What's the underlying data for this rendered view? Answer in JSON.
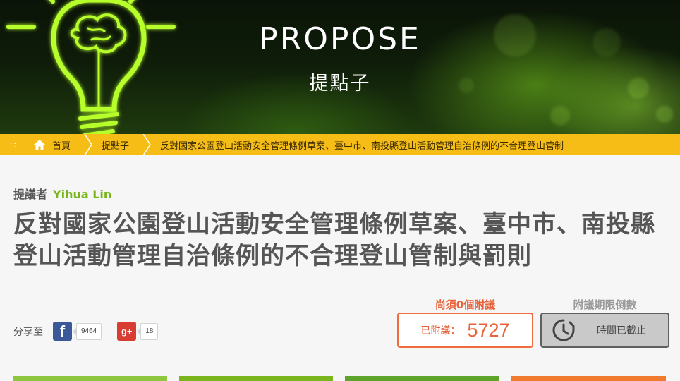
{
  "hero": {
    "title": "PROPOSE",
    "subtitle": "提點子"
  },
  "breadcrumb": {
    "menu_glyph": ":::",
    "items": [
      {
        "label": "首頁",
        "icon": "home-icon"
      },
      {
        "label": "提點子"
      },
      {
        "label": "反對國家公園登山活動安全管理條例草案、臺中市、南投縣登山活動管理自治條例的不合理登山管制"
      }
    ]
  },
  "proposal": {
    "proposer_label": "提議者",
    "proposer_name": "Yihua Lin",
    "title": "反對國家公園登山活動安全管理條例草案、臺中市、南投縣登山活動管理自治條例的不合理登山管制與罰則"
  },
  "share": {
    "label": "分享至",
    "facebook": {
      "icon": "facebook-icon",
      "glyph": "f",
      "count": "9464"
    },
    "google_plus": {
      "icon": "google-plus-icon",
      "glyph": "g+",
      "count": "18"
    }
  },
  "signatures": {
    "need_label": "尚須0個附議",
    "signed_label": "已附議：",
    "signed_value": "5727"
  },
  "deadline": {
    "label": "附議期限倒數",
    "icon": "clock-icon",
    "text": "時間已截止"
  },
  "colors": {
    "breadcrumb_bg": "#f6bd16",
    "accent_green": "#7ab51d",
    "signed_orange": "#ef6c3c",
    "facebook_blue": "#3b5998",
    "google_red": "#d73d32"
  }
}
